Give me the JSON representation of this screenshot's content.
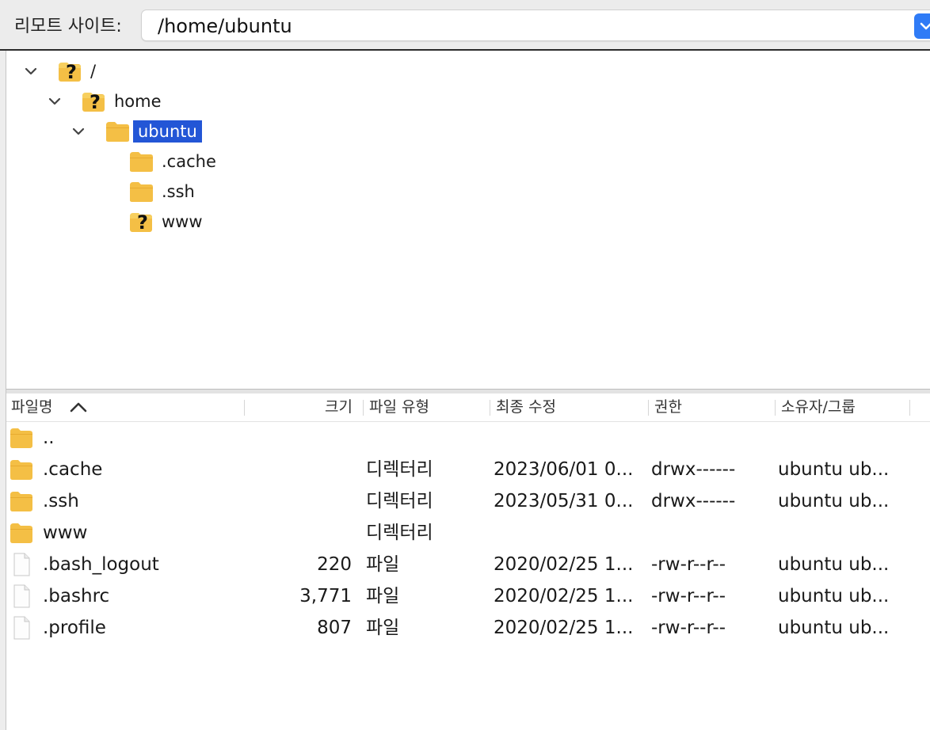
{
  "remote_site": {
    "label": "리모트 사이트:",
    "path": "/home/ubuntu",
    "accent_color": "#2f7bf6"
  },
  "tree": [
    {
      "label": "/",
      "icon": "unknown-folder-icon",
      "expanded": true,
      "selected": false
    },
    {
      "label": "home",
      "icon": "unknown-folder-icon",
      "expanded": true,
      "selected": false
    },
    {
      "label": "ubuntu",
      "icon": "folder-icon",
      "expanded": true,
      "selected": true
    },
    {
      "label": ".cache",
      "icon": "folder-icon",
      "expanded": false,
      "selected": false
    },
    {
      "label": ".ssh",
      "icon": "folder-icon",
      "expanded": false,
      "selected": false
    },
    {
      "label": "www",
      "icon": "unknown-folder-icon",
      "expanded": false,
      "selected": false
    }
  ],
  "selection_color": "#2356d6",
  "list": {
    "columns": {
      "name": "파일명",
      "size": "크기",
      "type": "파일 유형",
      "modified": "최종 수정",
      "permissions": "권한",
      "owner": "소유자/그룹"
    },
    "sort": {
      "column": "name",
      "direction": "ascending"
    },
    "rows": [
      {
        "name": "..",
        "size": "",
        "type": "",
        "modified": "",
        "permissions": "",
        "owner": "",
        "icon": "folder-icon"
      },
      {
        "name": ".cache",
        "size": "",
        "type": "디렉터리",
        "modified": "2023/06/01 0...",
        "permissions": "drwx------",
        "owner": "ubuntu ub...",
        "icon": "folder-icon"
      },
      {
        "name": ".ssh",
        "size": "",
        "type": "디렉터리",
        "modified": "2023/05/31 0...",
        "permissions": "drwx------",
        "owner": "ubuntu ub...",
        "icon": "folder-icon"
      },
      {
        "name": "www",
        "size": "",
        "type": "디렉터리",
        "modified": "",
        "permissions": "",
        "owner": "",
        "icon": "folder-icon"
      },
      {
        "name": ".bash_logout",
        "size": "220",
        "type": "파일",
        "modified": "2020/02/25 1...",
        "permissions": "-rw-r--r--",
        "owner": "ubuntu ub...",
        "icon": "file-icon"
      },
      {
        "name": ".bashrc",
        "size": "3,771",
        "type": "파일",
        "modified": "2020/02/25 1...",
        "permissions": "-rw-r--r--",
        "owner": "ubuntu ub...",
        "icon": "file-icon"
      },
      {
        "name": ".profile",
        "size": "807",
        "type": "파일",
        "modified": "2020/02/25 1...",
        "permissions": "-rw-r--r--",
        "owner": "ubuntu ub...",
        "icon": "file-icon"
      }
    ]
  }
}
